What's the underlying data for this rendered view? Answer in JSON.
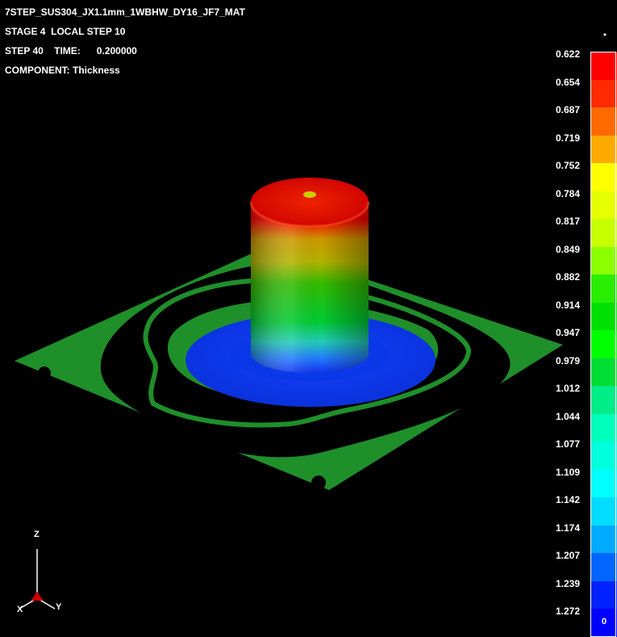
{
  "header": {
    "line1": "7STEP_SUS304_JX1.1mm_1WBHW_DY16_JF7_MAT",
    "line2": "STAGE 4  LOCAL STEP 10",
    "line3": "STEP 40    TIME:      0.200000",
    "line4": "COMPONENT: Thickness"
  },
  "legend": {
    "top_mark": "*",
    "bottom_mark": "0",
    "labels": [
      "0.622",
      "0.654",
      "0.687",
      "0.719",
      "0.752",
      "0.784",
      "0.817",
      "0.849",
      "0.882",
      "0.914",
      "0.947",
      "0.979",
      "1.012",
      "1.044",
      "1.077",
      "1.109",
      "1.142",
      "1.174",
      "1.207",
      "1.239",
      "1.272"
    ],
    "colors": [
      "#ff0000",
      "#ff2a00",
      "#ff6a00",
      "#ffaa00",
      "#ffff00",
      "#e6ff00",
      "#c8ff00",
      "#8cff00",
      "#2aee00",
      "#00e000",
      "#00ff00",
      "#00dd33",
      "#00ee88",
      "#00ffbb",
      "#00ffdd",
      "#00ffff",
      "#00ddff",
      "#00aaff",
      "#0066ff",
      "#0022ff",
      "#0000ff"
    ]
  },
  "triad": {
    "z": "Z",
    "x": "X",
    "y": "Y"
  }
}
